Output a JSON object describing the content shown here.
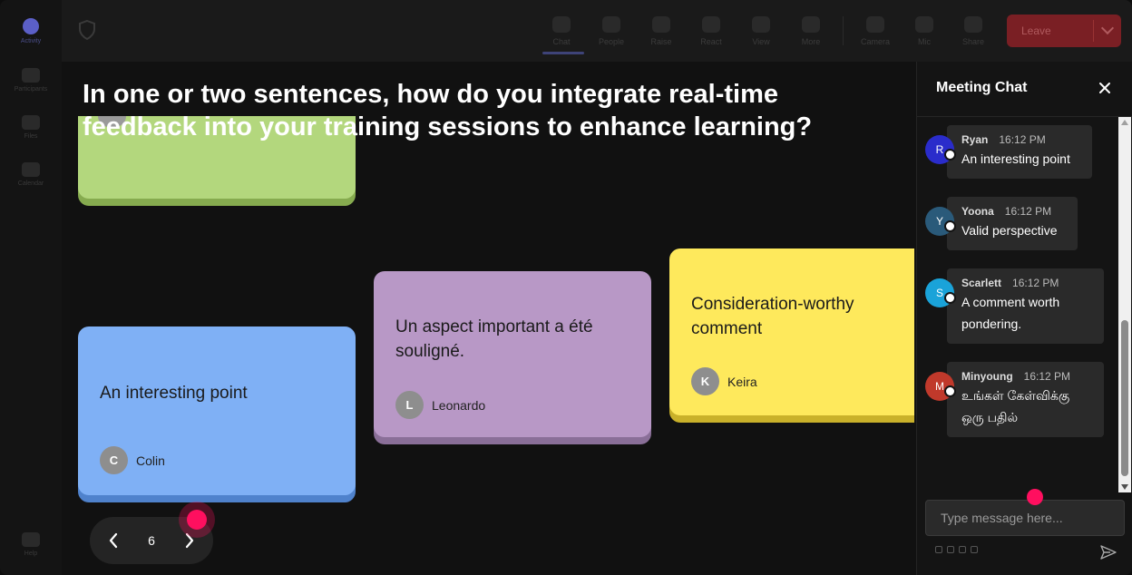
{
  "rail": {
    "items": [
      {
        "label": "Activity"
      },
      {
        "label": "Participants"
      },
      {
        "label": "Files"
      },
      {
        "label": "Calendar"
      },
      {
        "label": "Help"
      }
    ]
  },
  "toolbar": {
    "buttons": [
      {
        "label": "Chat",
        "icon": "chat-icon"
      },
      {
        "label": "People",
        "icon": "people-icon"
      },
      {
        "label": "Raise",
        "icon": "hand-icon"
      },
      {
        "label": "React",
        "icon": "smile-icon"
      },
      {
        "label": "View",
        "icon": "grid-icon"
      },
      {
        "label": "More",
        "icon": "more-icon"
      },
      {
        "label": "Camera",
        "icon": "camera-icon"
      },
      {
        "label": "Mic",
        "icon": "mic-icon"
      },
      {
        "label": "Share",
        "icon": "share-icon"
      }
    ],
    "leave_label": "Leave"
  },
  "stage": {
    "question": "In one or two sentences, how do you integrate real-time feedback into your training sessions to enhance learning?",
    "cards": [
      {
        "text": "An interesting point",
        "author": "Colin",
        "initial": "C",
        "color": "#7fb0f5"
      },
      {
        "text": "Un aspect important a été souligné.",
        "author": "Leonardo",
        "initial": "L",
        "color": "#b898c6"
      },
      {
        "text": "Consideration-worthy comment",
        "author": "Keira",
        "initial": "K",
        "color": "#fee95c"
      }
    ],
    "pager": {
      "page": "6"
    },
    "accent": "#ff0f5f"
  },
  "chat": {
    "title": "Meeting Chat",
    "messages": [
      {
        "name": "Ryan",
        "initial": "R",
        "time": "16:12 PM",
        "text": "An interesting point",
        "color": "#2a2ccb"
      },
      {
        "name": "Yoona",
        "initial": "Y",
        "time": "16:12 PM",
        "text": "Valid perspective",
        "color": "#2a5a7a"
      },
      {
        "name": "Scarlett",
        "initial": "S",
        "time": "16:12 PM",
        "text": "A comment worth pondering.",
        "color": "#1aa3d9"
      },
      {
        "name": "Minyoung",
        "initial": "M",
        "time": "16:12 PM",
        "text": "உங்கள் கேள்விக்கு ஒரு பதில்",
        "color": "#c0392b"
      }
    ],
    "input_placeholder": "Type message here..."
  }
}
